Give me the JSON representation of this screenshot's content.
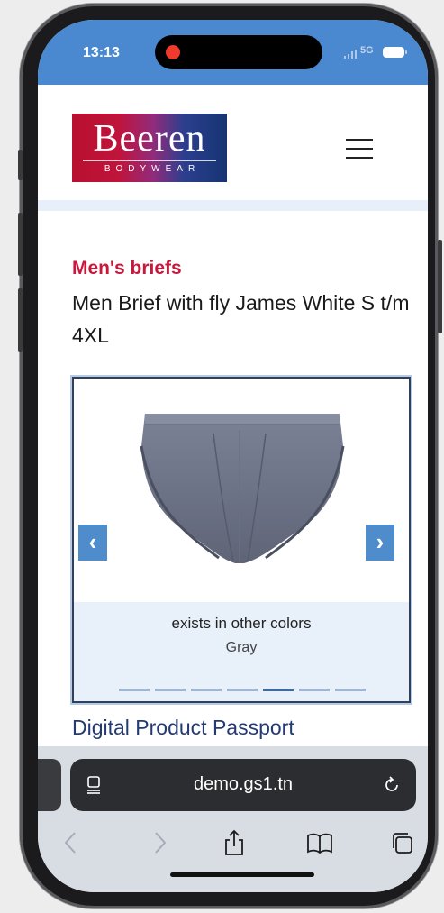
{
  "status_bar": {
    "time": "13:13",
    "network": "5G",
    "colors": {
      "bar": "#4a88d0",
      "record_dot": "#ef3b2b"
    }
  },
  "header": {
    "logo": {
      "word": "Beeren",
      "sub": "BODYWEAR"
    },
    "menu_icon": "hamburger-menu-icon"
  },
  "product": {
    "category": "Men's briefs",
    "title": "Men Brief with fly James White S t/m 4XL",
    "image": "gray-men-brief-image"
  },
  "carousel": {
    "caption": "exists in other colors",
    "color": "Gray",
    "prev_icon": "chevron-left-icon",
    "next_icon": "chevron-right-icon",
    "slide_count": 7,
    "active_slide": 5
  },
  "section": {
    "heading": "Digital Product Passport"
  },
  "browser": {
    "url": "demo.gs1.tn",
    "toolbar": [
      "back-icon",
      "forward-icon",
      "share-icon",
      "bookmarks-icon",
      "tabs-icon"
    ]
  },
  "colors": {
    "category": "#c8193c",
    "heading": "#233a75",
    "nav_button": "#4f8ccb"
  }
}
